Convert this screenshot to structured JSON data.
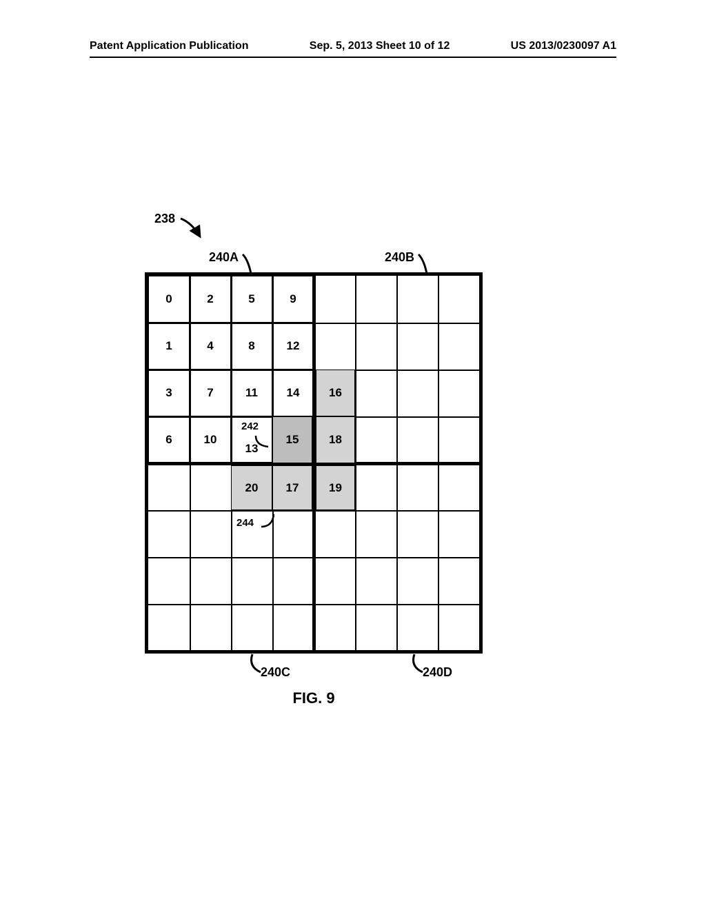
{
  "header": {
    "left": "Patent Application Publication",
    "center": "Sep. 5, 2013   Sheet 10 of 12",
    "right": "US 2013/0230097 A1"
  },
  "figure": {
    "caption": "FIG. 9",
    "ref_main": "238",
    "ref_top_left": "240A",
    "ref_top_right": "240B",
    "ref_bottom_left": "240C",
    "ref_bottom_right": "240D",
    "ref_inner_1": "242",
    "ref_inner_2": "244"
  },
  "grid": {
    "rows": 8,
    "cols": 8,
    "cells": [
      {
        "r": 0,
        "c": 0,
        "v": "0"
      },
      {
        "r": 0,
        "c": 1,
        "v": "2"
      },
      {
        "r": 0,
        "c": 2,
        "v": "5"
      },
      {
        "r": 0,
        "c": 3,
        "v": "9"
      },
      {
        "r": 1,
        "c": 0,
        "v": "1"
      },
      {
        "r": 1,
        "c": 1,
        "v": "4"
      },
      {
        "r": 1,
        "c": 2,
        "v": "8"
      },
      {
        "r": 1,
        "c": 3,
        "v": "12"
      },
      {
        "r": 2,
        "c": 0,
        "v": "3"
      },
      {
        "r": 2,
        "c": 1,
        "v": "7"
      },
      {
        "r": 2,
        "c": 2,
        "v": "11"
      },
      {
        "r": 2,
        "c": 3,
        "v": "14"
      },
      {
        "r": 2,
        "c": 4,
        "v": "16",
        "shade": 2
      },
      {
        "r": 3,
        "c": 0,
        "v": "6"
      },
      {
        "r": 3,
        "c": 1,
        "v": "10"
      },
      {
        "r": 3,
        "c": 2,
        "v": "13",
        "extra": "242"
      },
      {
        "r": 3,
        "c": 3,
        "v": "15",
        "shade": 1
      },
      {
        "r": 3,
        "c": 4,
        "v": "18",
        "shade": 2
      },
      {
        "r": 4,
        "c": 2,
        "v": "20",
        "shade": 2
      },
      {
        "r": 4,
        "c": 3,
        "v": "17",
        "shade": 2
      },
      {
        "r": 4,
        "c": 4,
        "v": "19",
        "shade": 2
      },
      {
        "r": 5,
        "c": 2,
        "extra": "244"
      }
    ]
  }
}
